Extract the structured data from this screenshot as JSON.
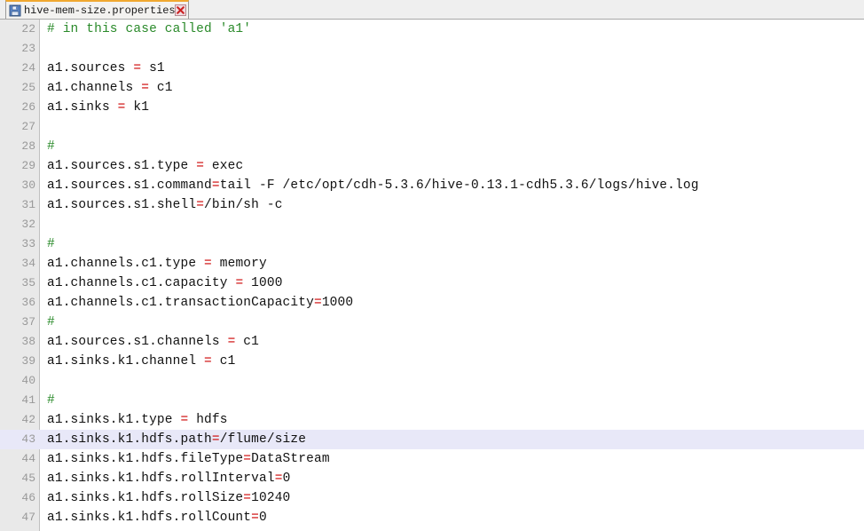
{
  "window": {
    "title": "hive-mem-size.properties"
  },
  "tab": {
    "label": "hive-mem-size.properties",
    "icon": "save-disk-icon",
    "close_icon": "close-x-icon",
    "active_accent_color": "#f0a830",
    "close_color": "#cc2222"
  },
  "colors": {
    "comment": "#2a8a2a",
    "operator": "#cc0000",
    "text": "#111111",
    "gutter_bg": "#e9e9e9",
    "gutter_text": "#999999",
    "current_line_bg": "#e8e8f8",
    "background": "#ffffff"
  },
  "editor": {
    "first_line": 22,
    "current_line": 43,
    "lines": [
      {
        "n": "22",
        "parts": [
          {
            "t": "comment",
            "s": "# in this case called 'a1'"
          }
        ]
      },
      {
        "n": "23",
        "parts": []
      },
      {
        "n": "24",
        "parts": [
          {
            "t": "key",
            "s": "a1.sources "
          },
          {
            "t": "eq",
            "s": "="
          },
          {
            "t": "val",
            "s": " s1"
          }
        ]
      },
      {
        "n": "25",
        "parts": [
          {
            "t": "key",
            "s": "a1.channels "
          },
          {
            "t": "eq",
            "s": "="
          },
          {
            "t": "val",
            "s": " c1"
          }
        ]
      },
      {
        "n": "26",
        "parts": [
          {
            "t": "key",
            "s": "a1.sinks "
          },
          {
            "t": "eq",
            "s": "="
          },
          {
            "t": "val",
            "s": " k1"
          }
        ]
      },
      {
        "n": "27",
        "parts": []
      },
      {
        "n": "28",
        "parts": [
          {
            "t": "comment",
            "s": "#"
          }
        ]
      },
      {
        "n": "29",
        "parts": [
          {
            "t": "key",
            "s": "a1.sources.s1.type "
          },
          {
            "t": "eq",
            "s": "="
          },
          {
            "t": "val",
            "s": " exec"
          }
        ]
      },
      {
        "n": "30",
        "parts": [
          {
            "t": "key",
            "s": "a1.sources.s1.command"
          },
          {
            "t": "eq",
            "s": "="
          },
          {
            "t": "val",
            "s": "tail -F /etc/opt/cdh-5.3.6/hive-0.13.1-cdh5.3.6/logs/hive.log"
          }
        ]
      },
      {
        "n": "31",
        "parts": [
          {
            "t": "key",
            "s": "a1.sources.s1.shell"
          },
          {
            "t": "eq",
            "s": "="
          },
          {
            "t": "val",
            "s": "/bin/sh -c"
          }
        ]
      },
      {
        "n": "32",
        "parts": []
      },
      {
        "n": "33",
        "parts": [
          {
            "t": "comment",
            "s": "#"
          }
        ]
      },
      {
        "n": "34",
        "parts": [
          {
            "t": "key",
            "s": "a1.channels.c1.type "
          },
          {
            "t": "eq",
            "s": "="
          },
          {
            "t": "val",
            "s": " memory"
          }
        ]
      },
      {
        "n": "35",
        "parts": [
          {
            "t": "key",
            "s": "a1.channels.c1.capacity "
          },
          {
            "t": "eq",
            "s": "="
          },
          {
            "t": "val",
            "s": " 1000"
          }
        ]
      },
      {
        "n": "36",
        "parts": [
          {
            "t": "key",
            "s": "a1.channels.c1.transactionCapacity"
          },
          {
            "t": "eq",
            "s": "="
          },
          {
            "t": "val",
            "s": "1000"
          }
        ]
      },
      {
        "n": "37",
        "parts": [
          {
            "t": "comment",
            "s": "#"
          }
        ]
      },
      {
        "n": "38",
        "parts": [
          {
            "t": "key",
            "s": "a1.sources.s1.channels "
          },
          {
            "t": "eq",
            "s": "="
          },
          {
            "t": "val",
            "s": " c1"
          }
        ]
      },
      {
        "n": "39",
        "parts": [
          {
            "t": "key",
            "s": "a1.sinks.k1.channel "
          },
          {
            "t": "eq",
            "s": "="
          },
          {
            "t": "val",
            "s": " c1"
          }
        ]
      },
      {
        "n": "40",
        "parts": []
      },
      {
        "n": "41",
        "parts": [
          {
            "t": "comment",
            "s": "#"
          }
        ]
      },
      {
        "n": "42",
        "parts": [
          {
            "t": "key",
            "s": "a1.sinks.k1.type "
          },
          {
            "t": "eq",
            "s": "="
          },
          {
            "t": "val",
            "s": " hdfs"
          }
        ]
      },
      {
        "n": "43",
        "parts": [
          {
            "t": "key",
            "s": "a1.sinks.k1.hdfs.path"
          },
          {
            "t": "eq",
            "s": "="
          },
          {
            "t": "val",
            "s": "/flume/size"
          }
        ],
        "current": true
      },
      {
        "n": "44",
        "parts": [
          {
            "t": "key",
            "s": "a1.sinks.k1.hdfs.fileType"
          },
          {
            "t": "eq",
            "s": "="
          },
          {
            "t": "val",
            "s": "DataStream"
          }
        ]
      },
      {
        "n": "45",
        "parts": [
          {
            "t": "key",
            "s": "a1.sinks.k1.hdfs.rollInterval"
          },
          {
            "t": "eq",
            "s": "="
          },
          {
            "t": "val",
            "s": "0"
          }
        ]
      },
      {
        "n": "46",
        "parts": [
          {
            "t": "key",
            "s": "a1.sinks.k1.hdfs.rollSize"
          },
          {
            "t": "eq",
            "s": "="
          },
          {
            "t": "val",
            "s": "10240"
          }
        ]
      },
      {
        "n": "47",
        "parts": [
          {
            "t": "key",
            "s": "a1.sinks.k1.hdfs.rollCount"
          },
          {
            "t": "eq",
            "s": "="
          },
          {
            "t": "val",
            "s": "0"
          }
        ]
      }
    ]
  }
}
